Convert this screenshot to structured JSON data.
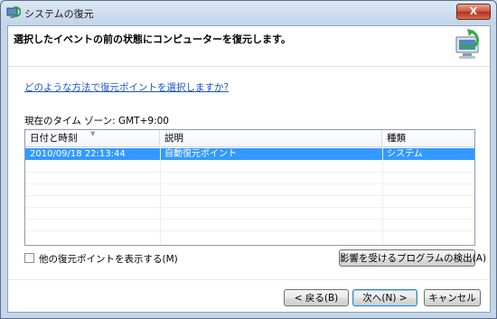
{
  "window": {
    "title": "システムの復元",
    "close_label": "X"
  },
  "header": {
    "title": "選択したイベントの前の状態にコンピューターを復元します。"
  },
  "help_link": "どのような方法で復元ポイントを選択しますか?",
  "timezone": "現在のタイム ゾーン: GMT+9:00",
  "table": {
    "columns": [
      "日付と時刻",
      "説明",
      "種類"
    ],
    "rows": [
      {
        "datetime": "2010/09/18 22:13:44",
        "description": "自動復元ポイント",
        "type": "システム",
        "selected": true
      }
    ]
  },
  "show_more_label": "他の復元ポイントを表示する(M)",
  "show_more_checked": false,
  "scan_button": "影響を受けるプログラムの検出(A)",
  "buttons": {
    "back": "< 戻る(B)",
    "next": "次へ(N) >",
    "cancel": "キャンセル"
  },
  "colors": {
    "selection": "#3399ff",
    "link": "#1c55c4",
    "close": "#c9533d"
  }
}
